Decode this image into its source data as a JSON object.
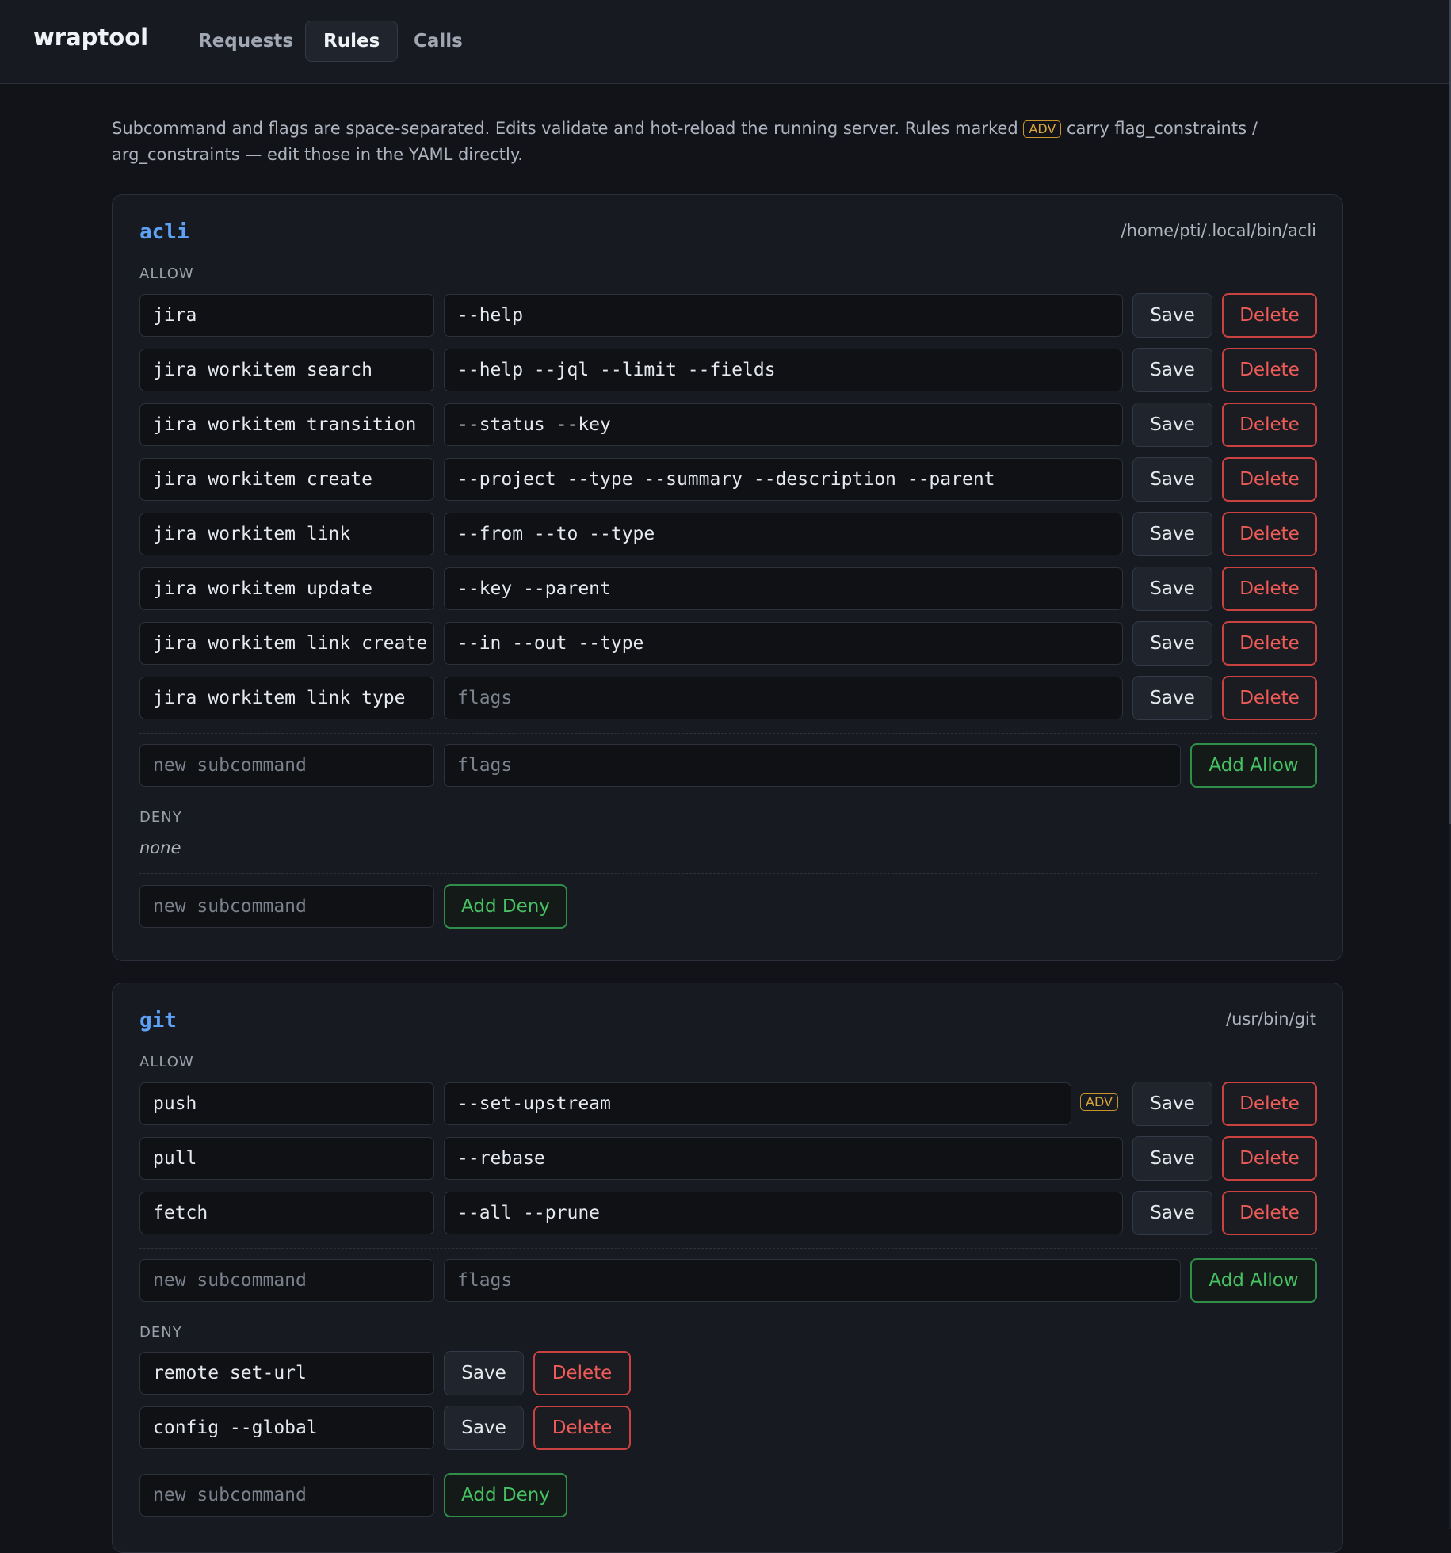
{
  "app": {
    "title": "wraptool",
    "tabs": [
      {
        "label": "Requests",
        "active": false
      },
      {
        "label": "Rules",
        "active": true
      },
      {
        "label": "Calls",
        "active": false
      }
    ]
  },
  "intro": {
    "text_before": "Subcommand and flags are space-separated. Edits validate and hot-reload the running server. Rules marked",
    "badge": "ADV",
    "text_after": "carry flag_constraints / arg_constraints — edit those in the YAML directly."
  },
  "labels": {
    "allow": "ALLOW",
    "deny": "DENY",
    "save": "Save",
    "delete": "Delete",
    "add_allow": "Add Allow",
    "add_deny": "Add Deny",
    "adv": "ADV",
    "none": "none",
    "new_subcommand_placeholder": "new subcommand",
    "flags_placeholder": "flags"
  },
  "tools": [
    {
      "name": "acli",
      "path": "/home/pti/.local/bin/acli",
      "allow": [
        {
          "subcommand": "jira",
          "flags": "--help"
        },
        {
          "subcommand": "jira workitem search",
          "flags": "--help --jql --limit --fields"
        },
        {
          "subcommand": "jira workitem transition",
          "flags": "--status --key"
        },
        {
          "subcommand": "jira workitem create",
          "flags": "--project --type --summary --description --parent"
        },
        {
          "subcommand": "jira workitem link",
          "flags": "--from --to --type"
        },
        {
          "subcommand": "jira workitem update",
          "flags": "--key --parent"
        },
        {
          "subcommand": "jira workitem link create",
          "flags": "--in --out --type"
        },
        {
          "subcommand": "jira workitem link type",
          "flags": ""
        }
      ],
      "deny": []
    },
    {
      "name": "git",
      "path": "/usr/bin/git",
      "allow": [
        {
          "subcommand": "push",
          "flags": "--set-upstream",
          "adv": true
        },
        {
          "subcommand": "pull",
          "flags": "--rebase"
        },
        {
          "subcommand": "fetch",
          "flags": "--all --prune"
        }
      ],
      "deny": [
        {
          "subcommand": "remote set-url"
        },
        {
          "subcommand": "config --global"
        }
      ]
    }
  ]
}
